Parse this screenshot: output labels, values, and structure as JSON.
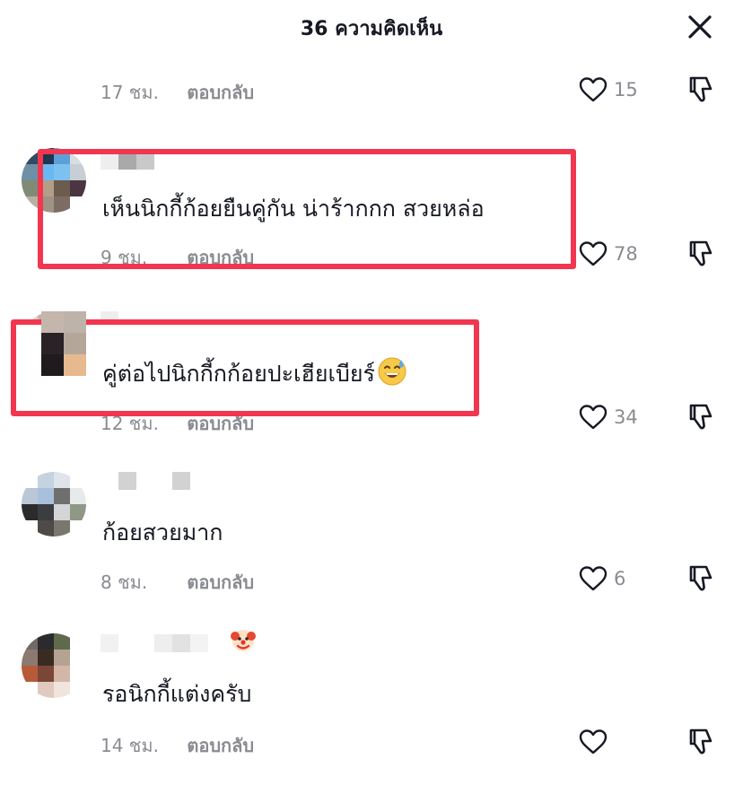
{
  "header": {
    "title": "36 ความคิดเห็น",
    "close_icon": "close-icon"
  },
  "comments": [
    {
      "text": "",
      "time": "17 ชม.",
      "reply_label": "ตอบกลับ",
      "likes": "15"
    },
    {
      "text": "เห็นนิกกี้ก้อยยืนคู่กัน น่าร้ากกก สวยหล่อ",
      "time": "9 ชม.",
      "reply_label": "ตอบกลับ",
      "likes": "78"
    },
    {
      "text": "คู่ต่อไปนิกกี้กก้อยปะเฮียเบียร์",
      "emoji": "grinning-face-with-sweat-icon",
      "time": "12 ชม.",
      "reply_label": "ตอบกลับ",
      "likes": "34"
    },
    {
      "text": "ก้อยสวยมาก",
      "time": "8 ชม.",
      "reply_label": "ตอบกลับ",
      "likes": "6"
    },
    {
      "text": "รอนิกกี้แต่งครับ",
      "name_emoji": "clown-face-icon",
      "time": "14 ชม.",
      "reply_label": "ตอบกลับ",
      "likes": ""
    }
  ],
  "colors": {
    "highlight": "#f2364f",
    "secondary_text": "#8a8b91",
    "primary_text": "#161823"
  }
}
